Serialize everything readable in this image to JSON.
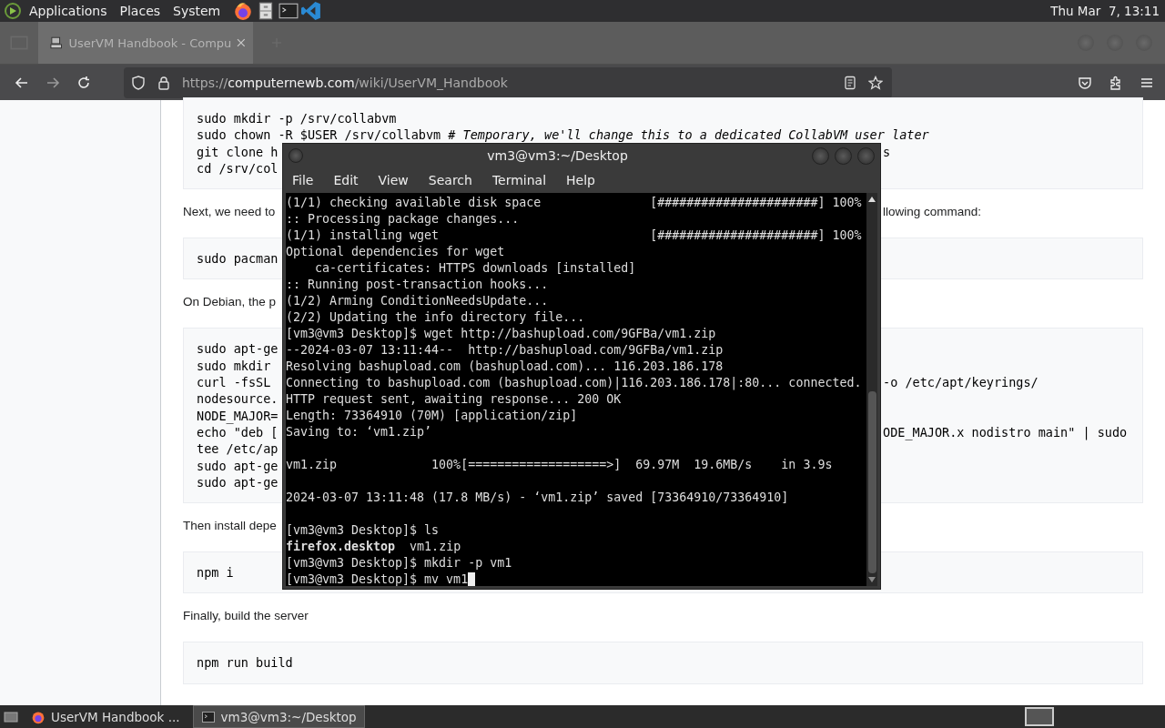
{
  "top_panel": {
    "menus": [
      "Applications",
      "Places",
      "System"
    ],
    "clock": "Thu Mar  7, 13:11"
  },
  "browser": {
    "tab": {
      "title": "UserVM Handbook - Compu",
      "selected": true
    },
    "url": {
      "prefix": "https://",
      "host": "computernewb.com",
      "path": "/wiki/UserVM_Handbook"
    },
    "page": [
      {
        "kind": "code",
        "lines": [
          {
            "left": "sudo mkdir -p /srv/collabvm"
          },
          {
            "left": "sudo chown -R $USER /srv/collabvm *# Temporary, we'll change this to a dedicated CollabVM user later*"
          },
          {
            "left": "git clone h",
            "right": "s"
          },
          {
            "left": "cd /srv/col"
          }
        ]
      },
      {
        "kind": "text",
        "left": "Next, we need to",
        "right": "llowing command:"
      },
      {
        "kind": "code",
        "lines": [
          {
            "left": "sudo pacman"
          }
        ]
      },
      {
        "kind": "text",
        "left": "On Debian, the p"
      },
      {
        "kind": "code",
        "lines": [
          {
            "left": "sudo apt-ge"
          },
          {
            "left": "sudo mkdir "
          },
          {
            "left": "curl -fsSL ",
            "right": "-o /etc/apt/keyrings/"
          },
          {
            "left": "nodesource."
          },
          {
            "left": "NODE_MAJOR="
          },
          {
            "left": "echo \"deb [",
            "right": "ODE_MAJOR.x nodistro main\" | sudo"
          },
          {
            "left": "tee /etc/ap"
          },
          {
            "left": "sudo apt-ge"
          },
          {
            "left": "sudo apt-ge"
          }
        ]
      },
      {
        "kind": "text",
        "left": "Then install depe"
      },
      {
        "kind": "code",
        "lines": [
          {
            "left": "npm i"
          }
        ]
      },
      {
        "kind": "text",
        "left": "Finally, build the server"
      },
      {
        "kind": "code",
        "lines": [
          {
            "left": "npm run build"
          }
        ]
      }
    ]
  },
  "terminal": {
    "title": "vm3@vm3:~/Desktop",
    "menus": [
      "File",
      "Edit",
      "View",
      "Search",
      "Terminal",
      "Help"
    ],
    "cursor": true,
    "lines": [
      {
        "text": "(1/1) checking available disk space               [######################] 100%"
      },
      {
        "text": ":: Processing package changes..."
      },
      {
        "text": "(1/1) installing wget                             [######################] 100%"
      },
      {
        "text": "Optional dependencies for wget"
      },
      {
        "text": "    ca-certificates: HTTPS downloads [installed]"
      },
      {
        "text": ":: Running post-transaction hooks..."
      },
      {
        "text": "(1/2) Arming ConditionNeedsUpdate..."
      },
      {
        "text": "(2/2) Updating the info directory file..."
      },
      {
        "text": "[vm3@vm3 Desktop]$ wget http://bashupload.com/9GFBa/vm1.zip"
      },
      {
        "text": "--2024-03-07 13:11:44--  http://bashupload.com/9GFBa/vm1.zip"
      },
      {
        "text": "Resolving bashupload.com (bashupload.com)... 116.203.186.178"
      },
      {
        "text": "Connecting to bashupload.com (bashupload.com)|116.203.186.178|:80... connected."
      },
      {
        "text": "HTTP request sent, awaiting response... 200 OK"
      },
      {
        "text": "Length: 73364910 (70M) [application/zip]"
      },
      {
        "text": "Saving to: ‘vm1.zip’"
      },
      {
        "text": "vm1.zip             100%[===================>]  69.97M  19.6MB/s    in 3.9s",
        "blank_before": true
      },
      {
        "text": "2024-03-07 13:11:48 (17.8 MB/s) - ‘vm1.zip’ saved [73364910/73364910]",
        "blank_before": true
      },
      {
        "text": "[vm3@vm3 Desktop]$ ls",
        "blank_before": true
      },
      {
        "text": "**firefox.desktop**  vm1.zip"
      },
      {
        "text": "[vm3@vm3 Desktop]$ mkdir -p vm1"
      },
      {
        "text": "[vm3@vm3 Desktop]$ mv vm1"
      }
    ]
  },
  "taskbar": {
    "items": [
      {
        "title": "UserVM Handbook ...",
        "kind": "browser",
        "selected": false
      },
      {
        "title": "vm3@vm3:~/Desktop",
        "kind": "terminal",
        "selected": true
      }
    ]
  }
}
